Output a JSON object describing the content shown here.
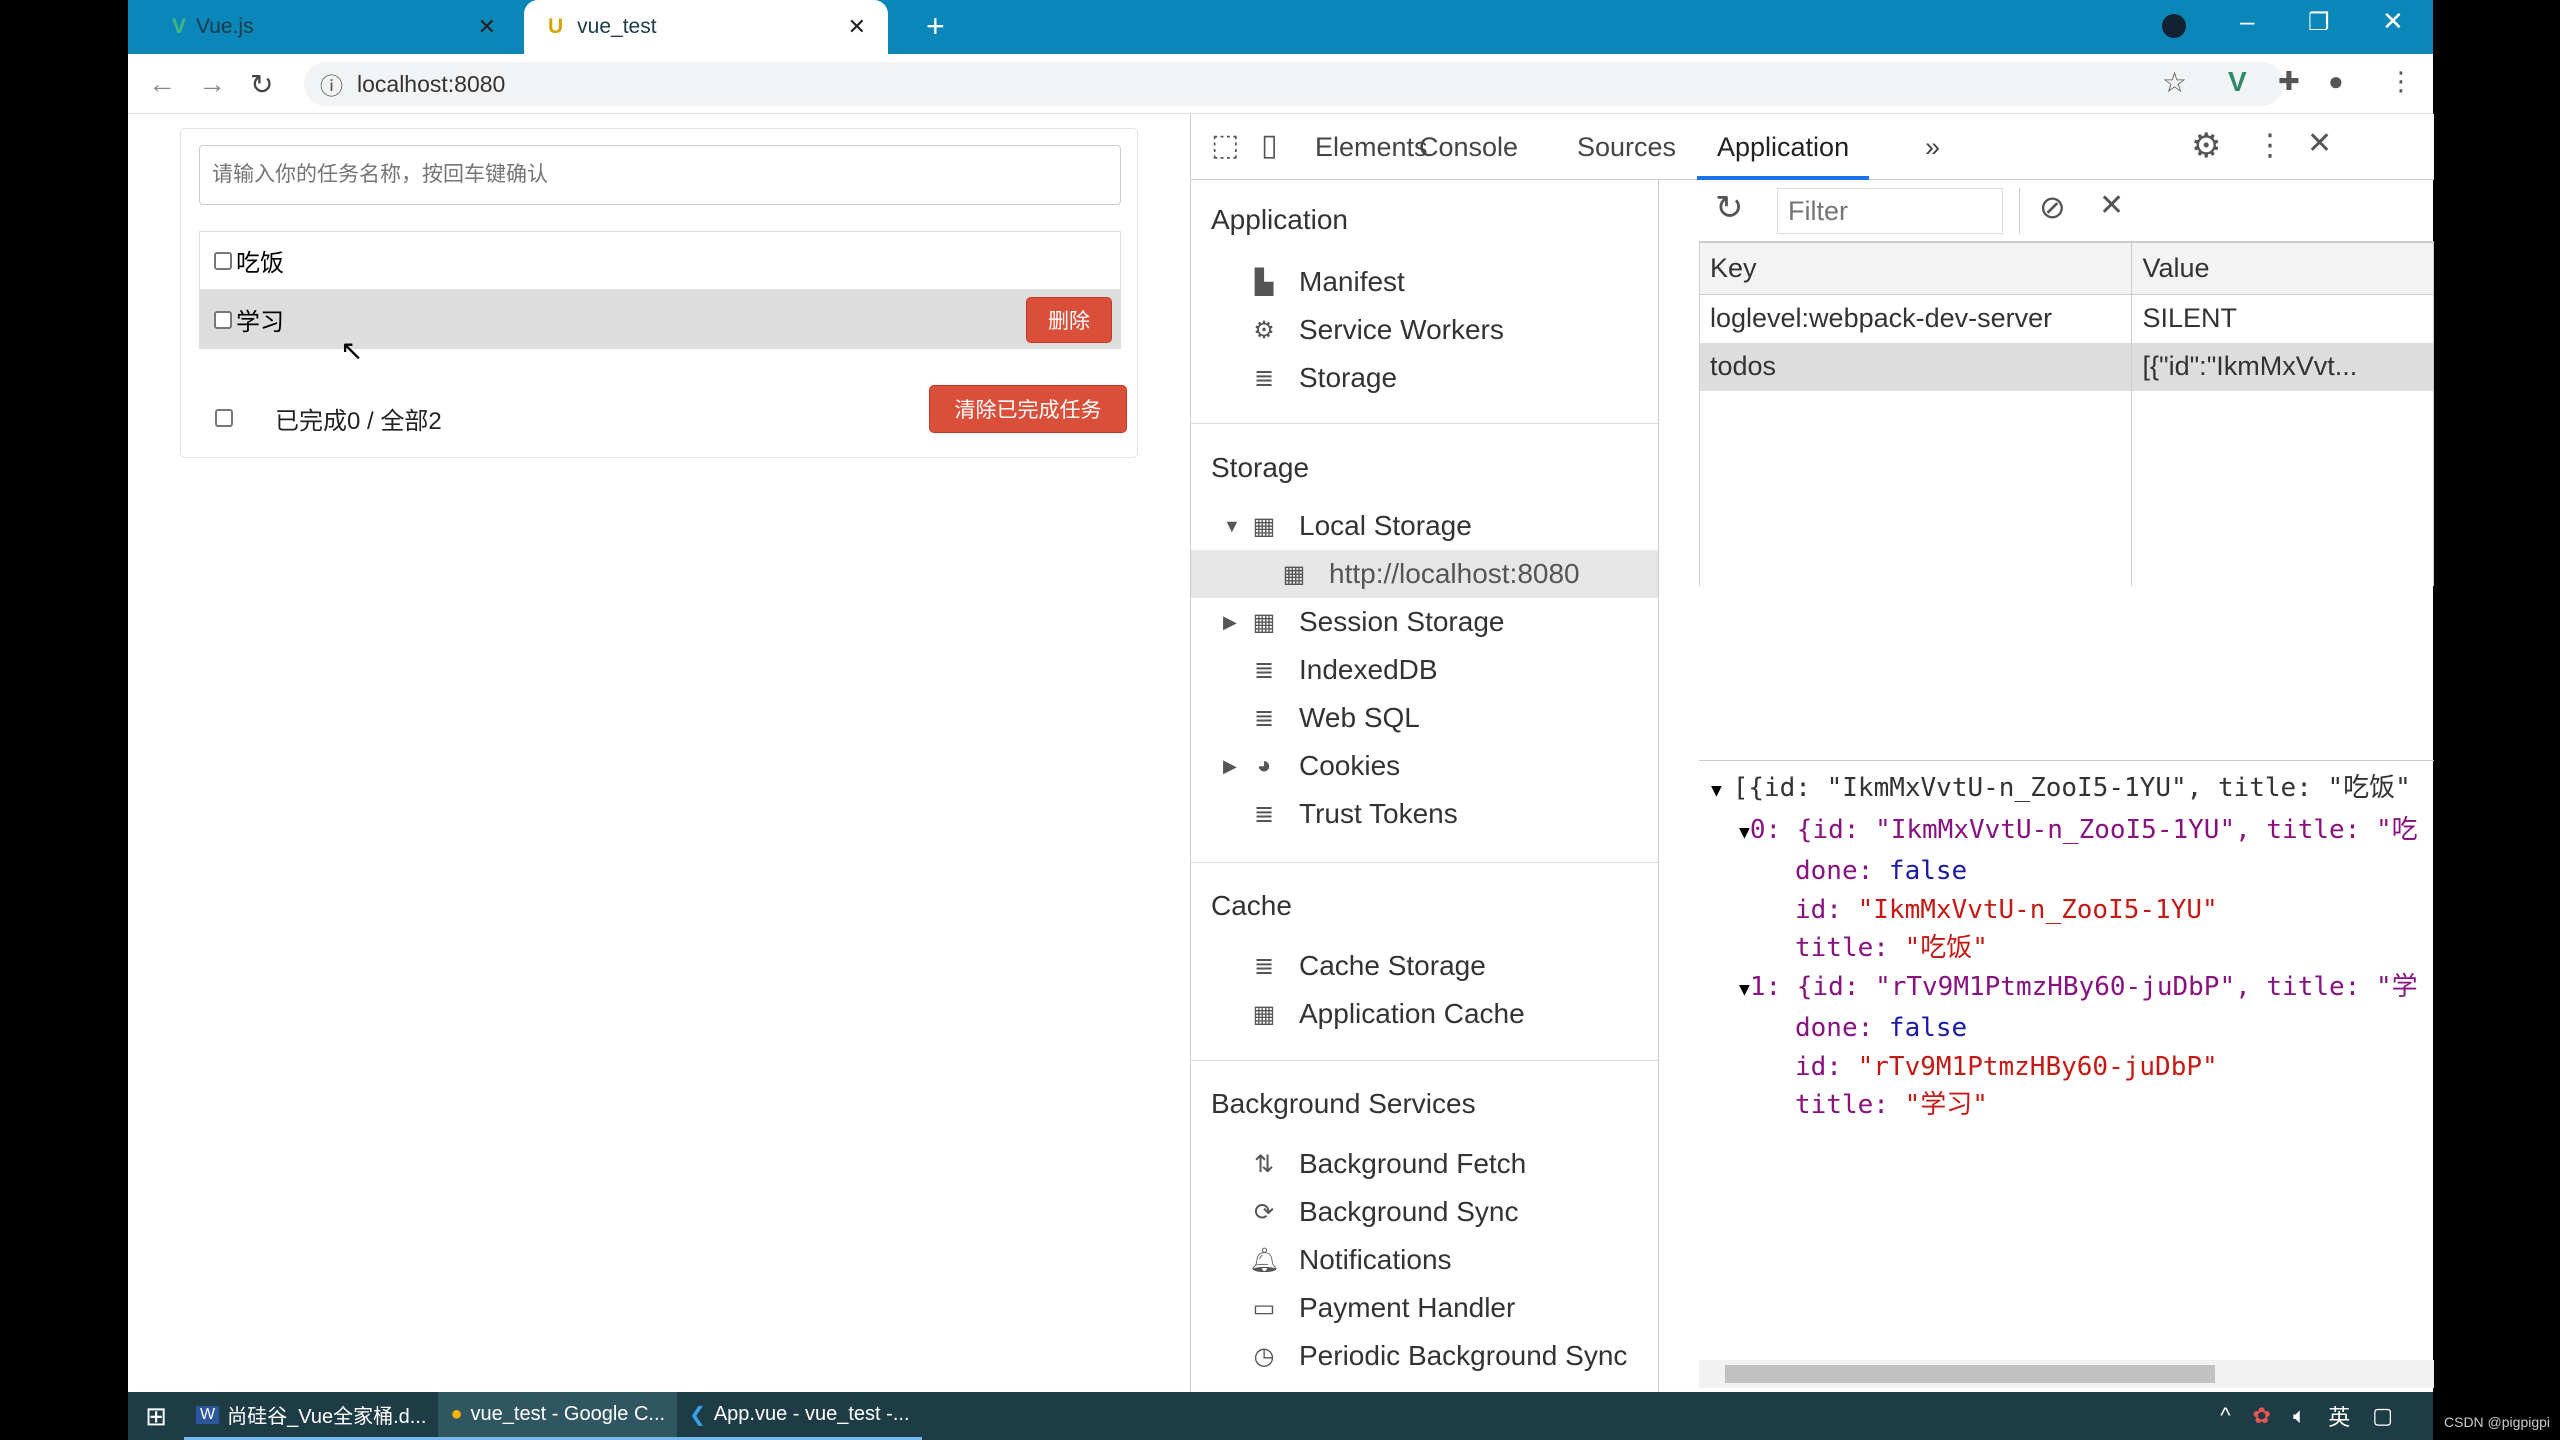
{
  "browser": {
    "tabs": [
      {
        "label": "Vue.js",
        "icon": "vue-logo-icon"
      },
      {
        "label": "vue_test",
        "icon": "vue-test-favicon"
      }
    ],
    "url": "localhost:8080"
  },
  "app": {
    "input_placeholder": "请输入你的任务名称，按回车键确认",
    "todos": [
      {
        "title": "吃饭",
        "done": false
      },
      {
        "title": "学习",
        "done": false
      }
    ],
    "delete_label": "删除",
    "footer_status": "已完成0 / 全部2",
    "clear_label": "清除已完成任务"
  },
  "devtools": {
    "tabs": [
      "Elements",
      "Console",
      "Sources",
      "Application"
    ],
    "active_tab": "Application",
    "sidebar": {
      "application_heading": "Application",
      "application_items": [
        "Manifest",
        "Service Workers",
        "Storage"
      ],
      "storage_heading": "Storage",
      "local_storage": "Local Storage",
      "local_origin": "http://localhost:8080",
      "storage_items": [
        "Session Storage",
        "IndexedDB",
        "Web SQL",
        "Cookies",
        "Trust Tokens"
      ],
      "cache_heading": "Cache",
      "cache_items": [
        "Cache Storage",
        "Application Cache"
      ],
      "bg_heading": "Background Services",
      "bg_items": [
        "Background Fetch",
        "Background Sync",
        "Notifications",
        "Payment Handler",
        "Periodic Background Sync"
      ]
    },
    "filter_placeholder": "Filter",
    "table": {
      "headers": [
        "Key",
        "Value"
      ],
      "rows": [
        {
          "key": "loglevel:webpack-dev-server",
          "value": "SILENT"
        },
        {
          "key": "todos",
          "value": "[{\"id\":\"IkmMxVvt..."
        }
      ]
    },
    "preview": {
      "summary": "[{id: \"IkmMxVvtU-n_ZooI5-1YU\", title: \"吃饭\"",
      "items": [
        {
          "head": "0: {id: \"IkmMxVvtU-n_ZooI5-1YU\", title: \"吃",
          "done": "false",
          "id": "\"IkmMxVvtU-n_ZooI5-1YU\"",
          "title": "\"吃饭\""
        },
        {
          "head": "1: {id: \"rTv9M1PtmzHBy60-juDbP\", title: \"学",
          "done": "false",
          "id": "\"rTv9M1PtmzHBy60-juDbP\"",
          "title": "\"学习\""
        }
      ],
      "labels": {
        "done": "done: ",
        "id": "id: ",
        "title": "title: "
      }
    }
  },
  "taskbar": {
    "items": [
      "尚硅谷_Vue全家桶.d...",
      "vue_test - Google C...",
      "App.vue - vue_test -..."
    ],
    "ime": "英",
    "watermark": "CSDN @pigpigpi"
  }
}
